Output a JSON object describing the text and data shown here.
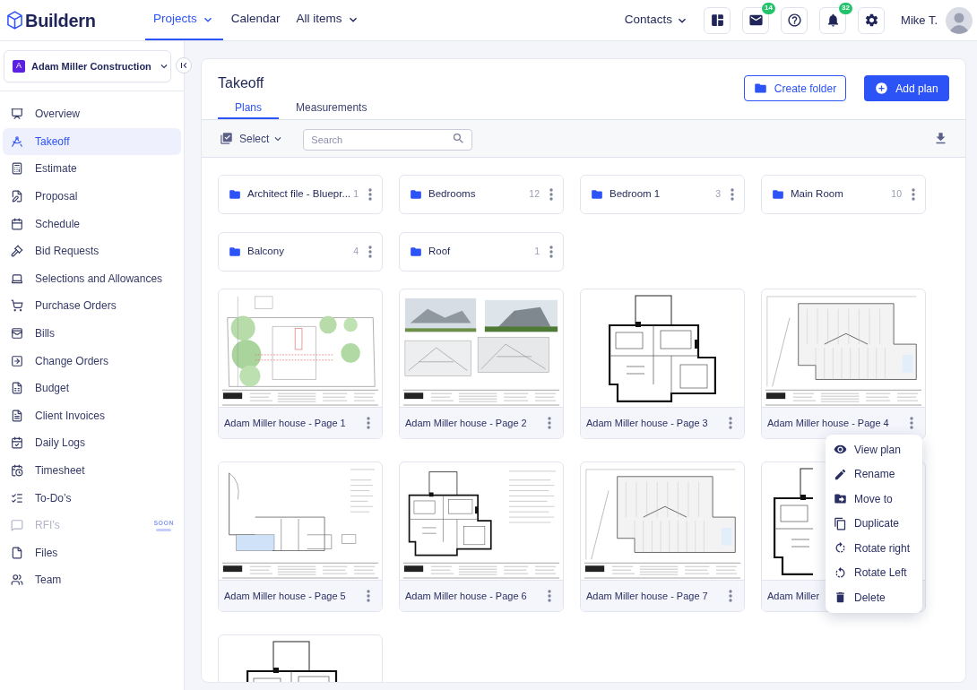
{
  "header": {
    "brand": "Buildern",
    "nav": [
      {
        "label": "Projects",
        "selected": true,
        "dropdown": true
      },
      {
        "label": "Calendar",
        "selected": false,
        "dropdown": false
      },
      {
        "label": "All items",
        "selected": false,
        "dropdown": true
      }
    ],
    "contacts": {
      "label": "Contacts",
      "dropdown": true
    },
    "mail_badge": "14",
    "notifications_badge": "32",
    "user": {
      "name": "Mike T."
    }
  },
  "sidebar": {
    "company": {
      "initial": "A",
      "name": "Adam Miller Construction"
    },
    "items": [
      {
        "label": "Overview",
        "selected": false,
        "disabled": false
      },
      {
        "label": "Takeoff",
        "selected": true,
        "disabled": false
      },
      {
        "label": "Estimate",
        "selected": false,
        "disabled": false
      },
      {
        "label": "Proposal",
        "selected": false,
        "disabled": false
      },
      {
        "label": "Schedule",
        "selected": false,
        "disabled": false
      },
      {
        "label": "Bid Requests",
        "selected": false,
        "disabled": false
      },
      {
        "label": "Selections and Allowances",
        "selected": false,
        "disabled": false
      },
      {
        "label": "Purchase Orders",
        "selected": false,
        "disabled": false
      },
      {
        "label": "Bills",
        "selected": false,
        "disabled": false
      },
      {
        "label": "Change Orders",
        "selected": false,
        "disabled": false
      },
      {
        "label": "Budget",
        "selected": false,
        "disabled": false
      },
      {
        "label": "Client Invoices",
        "selected": false,
        "disabled": false
      },
      {
        "label": "Daily Logs",
        "selected": false,
        "disabled": false
      },
      {
        "label": "Timesheet",
        "selected": false,
        "disabled": false
      },
      {
        "label": "To-Do’s",
        "selected": false,
        "disabled": false
      },
      {
        "label": "RFI’s",
        "selected": false,
        "disabled": true,
        "badge": "SOON"
      },
      {
        "label": "Files",
        "selected": false,
        "disabled": false
      },
      {
        "label": "Team",
        "selected": false,
        "disabled": false
      }
    ]
  },
  "page": {
    "title": "Takeoff",
    "tabs": [
      {
        "label": "Plans",
        "selected": true
      },
      {
        "label": "Measurements",
        "selected": false
      }
    ],
    "buttons": [
      {
        "label": "Create folder",
        "kind": "outline"
      },
      {
        "label": "Add plan",
        "kind": "primary"
      }
    ],
    "toolbar": {
      "select_label": "Select",
      "search": {
        "placeholder": "Search"
      }
    },
    "folders": [
      {
        "name": "Architect file - Bluepr...",
        "count": "1"
      },
      {
        "name": "Bedrooms",
        "count": "12"
      },
      {
        "name": "Bedroom 1",
        "count": "3"
      },
      {
        "name": "Main Room",
        "count": "10"
      },
      {
        "name": "Balcony",
        "count": "4"
      },
      {
        "name": "Roof",
        "count": "1"
      }
    ],
    "plans": [
      {
        "name": "Adam Miller house - Page 1",
        "more_button": true,
        "menu_open": false
      },
      {
        "name": "Adam Miller house - Page 2",
        "more_button": true,
        "menu_open": false
      },
      {
        "name": "Adam Miller house - Page 3",
        "more_button": true,
        "menu_open": false
      },
      {
        "name": "Adam Miller house - Page 4",
        "more_button": true,
        "menu_open": true
      },
      {
        "name": "Adam Miller house - Page 5",
        "more_button": true,
        "menu_open": false
      },
      {
        "name": "Adam Miller house - Page 6",
        "more_button": true,
        "menu_open": false
      },
      {
        "name": "Adam Miller house - Page 7",
        "more_button": true,
        "menu_open": false
      },
      {
        "name": "Adam Miller",
        "more_button": false,
        "menu_open": false
      },
      {
        "more_button": false,
        "menu_open": false
      }
    ],
    "context_menu": {
      "items": [
        {
          "label": "View plan"
        },
        {
          "label": "Rename"
        },
        {
          "label": "Move to"
        },
        {
          "label": "Duplicate"
        },
        {
          "label": "Rotate right"
        },
        {
          "label": "Rotate Left"
        },
        {
          "label": "Delete"
        }
      ]
    }
  }
}
